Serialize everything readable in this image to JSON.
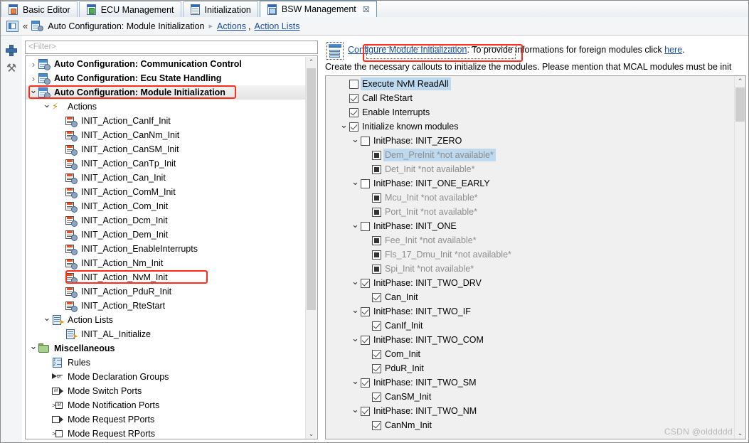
{
  "tabs": [
    {
      "label": "Basic Editor",
      "icon": "editor-icon",
      "active": false,
      "closable": false
    },
    {
      "label": "ECU Management",
      "icon": "ecu-icon",
      "active": false,
      "closable": false
    },
    {
      "label": "Initialization",
      "icon": "initialization-icon",
      "active": false,
      "closable": false
    },
    {
      "label": "BSW Management",
      "icon": "bsw-icon",
      "active": true,
      "closable": true,
      "close_glyph": "☒"
    }
  ],
  "breadcrumb": {
    "view_icon": "view-icon",
    "collapse_glyph": "«",
    "node_icon": "auto-configuration-icon",
    "title": "Auto Configuration: Module Initialization",
    "separator": "▸",
    "links": [
      "Actions",
      "Action Lists"
    ],
    "comma": ","
  },
  "rail": {
    "add_icon": "add-plus-icon",
    "tools_icon": "tools-icon",
    "tools_glyph": "⚒"
  },
  "left_panel": {
    "filter_placeholder": "<Filter>",
    "scroll_up_glyph": "⌃",
    "scroll_down_glyph": "⌄",
    "highlight_color": "#ff2d1a",
    "tree": [
      {
        "label": "Auto Configuration: Communication Control",
        "icon": "auto-configuration-icon",
        "indent": 0,
        "twisty": "collapsed",
        "bold": true,
        "highlighted": false
      },
      {
        "label": "Auto Configuration: Ecu State Handling",
        "icon": "auto-configuration-icon",
        "indent": 0,
        "twisty": "collapsed",
        "bold": true,
        "highlighted": false
      },
      {
        "label": "Auto Configuration: Module Initialization",
        "icon": "auto-configuration-icon",
        "indent": 0,
        "twisty": "open",
        "bold": true,
        "highlighted": true
      },
      {
        "label": "Actions",
        "icon": "actions-icon",
        "indent": 1,
        "twisty": "open",
        "bold": false,
        "highlighted": false
      },
      {
        "label": "INIT_Action_CanIf_Init",
        "icon": "init-action-icon",
        "indent": 2,
        "twisty": "none",
        "bold": false,
        "highlighted": false
      },
      {
        "label": "INIT_Action_CanNm_Init",
        "icon": "init-action-icon",
        "indent": 2,
        "twisty": "none",
        "bold": false,
        "highlighted": false
      },
      {
        "label": "INIT_Action_CanSM_Init",
        "icon": "init-action-icon",
        "indent": 2,
        "twisty": "none",
        "bold": false,
        "highlighted": false
      },
      {
        "label": "INIT_Action_CanTp_Init",
        "icon": "init-action-icon",
        "indent": 2,
        "twisty": "none",
        "bold": false,
        "highlighted": false
      },
      {
        "label": "INIT_Action_Can_Init",
        "icon": "init-action-icon",
        "indent": 2,
        "twisty": "none",
        "bold": false,
        "highlighted": false
      },
      {
        "label": "INIT_Action_ComM_Init",
        "icon": "init-action-icon",
        "indent": 2,
        "twisty": "none",
        "bold": false,
        "highlighted": false
      },
      {
        "label": "INIT_Action_Com_Init",
        "icon": "init-action-icon",
        "indent": 2,
        "twisty": "none",
        "bold": false,
        "highlighted": false
      },
      {
        "label": "INIT_Action_Dcm_Init",
        "icon": "init-action-icon",
        "indent": 2,
        "twisty": "none",
        "bold": false,
        "highlighted": false
      },
      {
        "label": "INIT_Action_Dem_Init",
        "icon": "init-action-icon",
        "indent": 2,
        "twisty": "none",
        "bold": false,
        "highlighted": false
      },
      {
        "label": "INIT_Action_EnableInterrupts",
        "icon": "init-action-icon",
        "indent": 2,
        "twisty": "none",
        "bold": false,
        "highlighted": false
      },
      {
        "label": "INIT_Action_Nm_Init",
        "icon": "init-action-icon",
        "indent": 2,
        "twisty": "none",
        "bold": false,
        "highlighted": false
      },
      {
        "label": "INIT_Action_NvM_Init",
        "icon": "init-action-icon",
        "indent": 2,
        "twisty": "none",
        "bold": false,
        "highlighted": true
      },
      {
        "label": "INIT_Action_PduR_Init",
        "icon": "init-action-icon",
        "indent": 2,
        "twisty": "none",
        "bold": false,
        "highlighted": false
      },
      {
        "label": "INIT_Action_RteStart",
        "icon": "init-action-icon",
        "indent": 2,
        "twisty": "none",
        "bold": false,
        "highlighted": false
      },
      {
        "label": "Action Lists",
        "icon": "action-list-icon",
        "indent": 1,
        "twisty": "open",
        "bold": false,
        "highlighted": false
      },
      {
        "label": "INIT_AL_Initialize",
        "icon": "action-list-icon",
        "indent": 2,
        "twisty": "none",
        "bold": false,
        "highlighted": false
      },
      {
        "label": "Miscellaneous",
        "icon": "folder-icon",
        "indent": 0,
        "twisty": "open",
        "bold": true,
        "highlighted": false
      },
      {
        "label": "Rules",
        "icon": "rules-icon",
        "indent": 1,
        "twisty": "none",
        "bold": false,
        "highlighted": false
      },
      {
        "label": "Mode Declaration Groups",
        "icon": "mode-declaration-group-icon",
        "indent": 1,
        "twisty": "none",
        "bold": false,
        "highlighted": false
      },
      {
        "label": "Mode Switch Ports",
        "icon": "mode-switch-port-icon",
        "indent": 1,
        "twisty": "none",
        "bold": false,
        "highlighted": false
      },
      {
        "label": "Mode Notification Ports",
        "icon": "mode-notification-port-icon",
        "indent": 1,
        "twisty": "none",
        "bold": false,
        "highlighted": false
      },
      {
        "label": "Mode Request PPorts",
        "icon": "mode-request-pport-icon",
        "indent": 1,
        "twisty": "none",
        "bold": false,
        "highlighted": false
      },
      {
        "label": "Mode Request RPorts",
        "icon": "mode-request-rport-icon",
        "indent": 1,
        "twisty": "none",
        "bold": false,
        "highlighted": false
      }
    ]
  },
  "right_panel": {
    "header_icon": "configure-window-icon",
    "link_text": "Configure Module Initialization",
    "after_link": ". To provide informations for foreign modules click ",
    "here_link": "here",
    "period": ".",
    "description": "Create the necessary callouts to initialize the modules. Please mention that MCAL modules must be init",
    "highlight_color": "#ff2d1a",
    "scroll_up_glyph": "⌃",
    "scroll_down_glyph": "⌄",
    "tree": [
      {
        "label": "Execute NvM ReadAll",
        "indent": 1,
        "twisty": "none",
        "check": "unchecked",
        "dim": false,
        "selected": true
      },
      {
        "label": "Call RteStart",
        "indent": 1,
        "twisty": "none",
        "check": "checked",
        "dim": false,
        "selected": false
      },
      {
        "label": "Enable Interrupts",
        "indent": 1,
        "twisty": "none",
        "check": "checked",
        "dim": false,
        "selected": false
      },
      {
        "label": "Initialize known modules",
        "indent": 1,
        "twisty": "open",
        "check": "checked",
        "dim": false,
        "selected": false
      },
      {
        "label": "InitPhase: INIT_ZERO",
        "indent": 2,
        "twisty": "open",
        "check": "unchecked",
        "dim": false,
        "selected": false
      },
      {
        "label": "Dem_PreInit *not available*",
        "indent": 3,
        "twisty": "none",
        "check": "solid",
        "dim": true,
        "selected": true
      },
      {
        "label": "Det_Init *not available*",
        "indent": 3,
        "twisty": "none",
        "check": "solid",
        "dim": true,
        "selected": false
      },
      {
        "label": "InitPhase: INIT_ONE_EARLY",
        "indent": 2,
        "twisty": "open",
        "check": "unchecked",
        "dim": false,
        "selected": false
      },
      {
        "label": "Mcu_Init *not available*",
        "indent": 3,
        "twisty": "none",
        "check": "solid",
        "dim": true,
        "selected": false
      },
      {
        "label": "Port_Init *not available*",
        "indent": 3,
        "twisty": "none",
        "check": "solid",
        "dim": true,
        "selected": false
      },
      {
        "label": "InitPhase: INIT_ONE",
        "indent": 2,
        "twisty": "open",
        "check": "unchecked",
        "dim": false,
        "selected": false
      },
      {
        "label": "Fee_Init *not available*",
        "indent": 3,
        "twisty": "none",
        "check": "solid",
        "dim": true,
        "selected": false
      },
      {
        "label": "Fls_17_Dmu_Init *not available*",
        "indent": 3,
        "twisty": "none",
        "check": "solid",
        "dim": true,
        "selected": false
      },
      {
        "label": "Spi_Init *not available*",
        "indent": 3,
        "twisty": "none",
        "check": "solid",
        "dim": true,
        "selected": false
      },
      {
        "label": "InitPhase: INIT_TWO_DRV",
        "indent": 2,
        "twisty": "open",
        "check": "checked",
        "dim": false,
        "selected": false
      },
      {
        "label": "Can_Init",
        "indent": 3,
        "twisty": "none",
        "check": "checked",
        "dim": false,
        "selected": false
      },
      {
        "label": "InitPhase: INIT_TWO_IF",
        "indent": 2,
        "twisty": "open",
        "check": "checked",
        "dim": false,
        "selected": false
      },
      {
        "label": "CanIf_Init",
        "indent": 3,
        "twisty": "none",
        "check": "checked",
        "dim": false,
        "selected": false
      },
      {
        "label": "InitPhase: INIT_TWO_COM",
        "indent": 2,
        "twisty": "open",
        "check": "checked",
        "dim": false,
        "selected": false
      },
      {
        "label": "Com_Init",
        "indent": 3,
        "twisty": "none",
        "check": "checked",
        "dim": false,
        "selected": false
      },
      {
        "label": "PduR_Init",
        "indent": 3,
        "twisty": "none",
        "check": "checked",
        "dim": false,
        "selected": false
      },
      {
        "label": "InitPhase: INIT_TWO_SM",
        "indent": 2,
        "twisty": "open",
        "check": "checked",
        "dim": false,
        "selected": false
      },
      {
        "label": "CanSM_Init",
        "indent": 3,
        "twisty": "none",
        "check": "checked",
        "dim": false,
        "selected": false
      },
      {
        "label": "InitPhase: INIT_TWO_NM",
        "indent": 2,
        "twisty": "open",
        "check": "checked",
        "dim": false,
        "selected": false
      },
      {
        "label": "CanNm_Init",
        "indent": 3,
        "twisty": "none",
        "check": "checked",
        "dim": false,
        "selected": false
      }
    ]
  },
  "watermark": "CSDN @olddddd"
}
